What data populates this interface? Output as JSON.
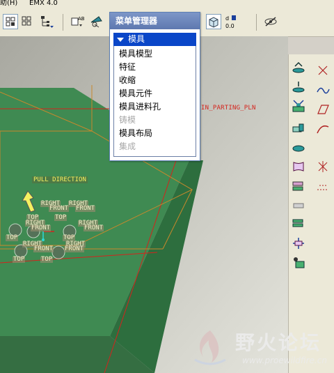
{
  "menubar": {
    "help": "助(H)",
    "emx": "EMX 4.0"
  },
  "menu_manager": {
    "title": "菜单管理器",
    "header": "模具",
    "items": [
      {
        "label": "模具模型",
        "enabled": true
      },
      {
        "label": "特征",
        "enabled": true
      },
      {
        "label": "收缩",
        "enabled": true
      },
      {
        "label": "模具元件",
        "enabled": true
      },
      {
        "label": "模具进料孔",
        "enabled": true
      },
      {
        "label": "铸模",
        "enabled": false
      },
      {
        "label": "模具布局",
        "enabled": true
      },
      {
        "label": "集成",
        "enabled": false
      }
    ]
  },
  "viewport": {
    "pull_direction": "PULL DIRECTION",
    "parting_plane": "IN_PARTING_PLN",
    "datum_labels": {
      "right": "RIGHT",
      "front": "FRONT",
      "top": "TOP"
    },
    "colors": {
      "mold_green": "#3f8a52",
      "parting_red": "#d4231c",
      "datum_orange": "#c8882c"
    }
  },
  "toolbar": {
    "counter": "0.0",
    "icons": [
      "view-icon",
      "layout-icon",
      "tree-icon",
      "datum-display-icon",
      "spin-icon",
      "shade-icon",
      "measure-icon",
      "hide-icon"
    ]
  },
  "right_toolbar": {
    "icons": [
      "mold-volume-icon",
      "mold-component-icon",
      "mold-base-icon",
      "cut-icon",
      "surface-icon",
      "parting-surface-icon",
      "sketch-icon",
      "mirror-icon",
      "runner-icon",
      "gate-icon",
      "assembly-icon",
      "split-icon",
      "open-icon",
      "waterline-icon",
      "ejector-icon"
    ]
  },
  "watermark": {
    "name": "野火论坛",
    "url": "www.proewildfire.cn"
  }
}
